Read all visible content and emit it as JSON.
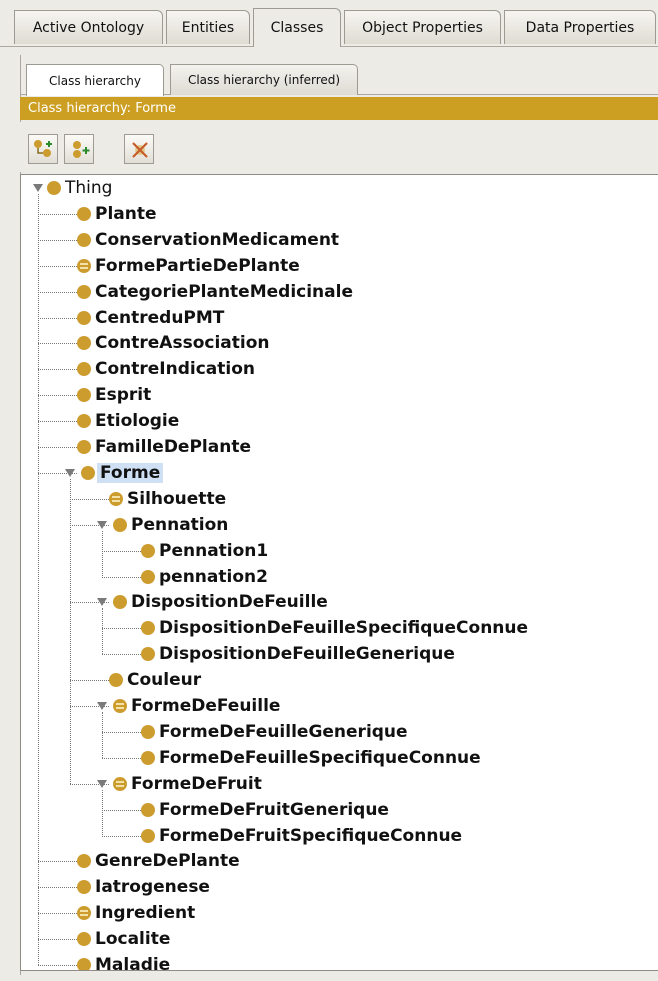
{
  "top_tabs": [
    {
      "label": "Active Ontology",
      "active": false
    },
    {
      "label": "Entities",
      "active": false
    },
    {
      "label": "Classes",
      "active": true
    },
    {
      "label": "Object Properties",
      "active": false
    },
    {
      "label": "Data Properties",
      "active": false
    }
  ],
  "sub_tabs": [
    {
      "label": "Class hierarchy",
      "active": true
    },
    {
      "label": "Class hierarchy (inferred)",
      "active": false
    }
  ],
  "view_header": "Class hierarchy: Forme",
  "toolbar": {
    "add_subclass_icon": "add-subclass-icon",
    "add_sibling_icon": "add-sibling-icon",
    "delete_class_icon": "delete-class-icon"
  },
  "colors": {
    "header": "#cc9f22",
    "class_dot": "#cd9c2e",
    "selection": "#cfe0f4"
  },
  "tree": [
    {
      "label": "Thing",
      "depth": 0,
      "expanded": true,
      "root": true
    },
    {
      "label": "Plante",
      "depth": 1
    },
    {
      "label": "ConservationMedicament",
      "depth": 1
    },
    {
      "label": "FormePartieDePlante",
      "depth": 1,
      "equivalent": true
    },
    {
      "label": "CategoriePlanteMedicinale",
      "depth": 1
    },
    {
      "label": "CentreduPMT",
      "depth": 1
    },
    {
      "label": "ContreAssociation",
      "depth": 1
    },
    {
      "label": "ContreIndication",
      "depth": 1
    },
    {
      "label": "Esprit",
      "depth": 1
    },
    {
      "label": "Etiologie",
      "depth": 1
    },
    {
      "label": "FamilleDePlante",
      "depth": 1
    },
    {
      "label": "Forme",
      "depth": 1,
      "expanded": true,
      "selected": true
    },
    {
      "label": "Silhouette",
      "depth": 2,
      "equivalent": true
    },
    {
      "label": "Pennation",
      "depth": 2,
      "expanded": true
    },
    {
      "label": "Pennation1",
      "depth": 3
    },
    {
      "label": "pennation2",
      "depth": 3
    },
    {
      "label": "DispositionDeFeuille",
      "depth": 2,
      "expanded": true
    },
    {
      "label": "DispositionDeFeuilleSpecifiqueConnue",
      "depth": 3
    },
    {
      "label": "DispositionDeFeuilleGenerique",
      "depth": 3
    },
    {
      "label": "Couleur",
      "depth": 2
    },
    {
      "label": "FormeDeFeuille",
      "depth": 2,
      "expanded": true,
      "equivalent": true
    },
    {
      "label": "FormeDeFeuilleGenerique",
      "depth": 3
    },
    {
      "label": "FormeDeFeuilleSpecifiqueConnue",
      "depth": 3
    },
    {
      "label": "FormeDeFruit",
      "depth": 2,
      "expanded": true,
      "equivalent": true
    },
    {
      "label": "FormeDeFruitGenerique",
      "depth": 3
    },
    {
      "label": "FormeDeFruitSpecifiqueConnue",
      "depth": 3
    },
    {
      "label": "GenreDePlante",
      "depth": 1
    },
    {
      "label": "Iatrogenese",
      "depth": 1
    },
    {
      "label": "Ingredient",
      "depth": 1,
      "equivalent": true
    },
    {
      "label": "Localite",
      "depth": 1
    },
    {
      "label": "Maladie",
      "depth": 1
    }
  ]
}
